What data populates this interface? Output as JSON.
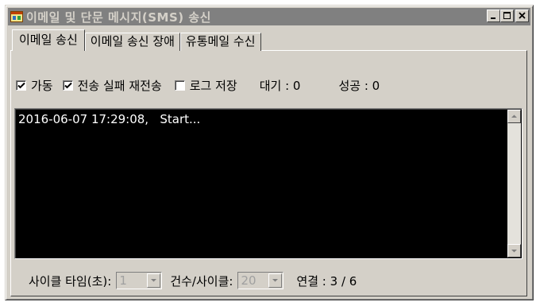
{
  "window": {
    "title": "이메일 및 단문 메시지(SMS) 송신",
    "icon": "app-window-icon"
  },
  "tabs": [
    {
      "label": "이메일 송신",
      "active": true
    },
    {
      "label": "이메일 송신 장애",
      "active": false
    },
    {
      "label": "유통메일 수신",
      "active": false
    }
  ],
  "options": {
    "active_label": "가동",
    "active_checked": true,
    "resend_label": "전송 실패 재전송",
    "resend_checked": true,
    "log_save_label": "로그 저장",
    "log_save_checked": false,
    "waiting_label": "대기 : 0",
    "success_label": "성공 : 0"
  },
  "log": {
    "lines": "2016-06-07 17:29:08,   Start..."
  },
  "footer": {
    "cycle_time_label": "사이클 타임(초):",
    "cycle_time_value": "1",
    "count_per_cycle_label": "건수/사이클:",
    "count_per_cycle_value": "20",
    "connection_label": "연결 : 3 / 6"
  },
  "colors": {
    "face": "#d4d0c8",
    "titlebar_inactive": "#808080",
    "log_background": "#000000",
    "log_text": "#ffffff"
  }
}
